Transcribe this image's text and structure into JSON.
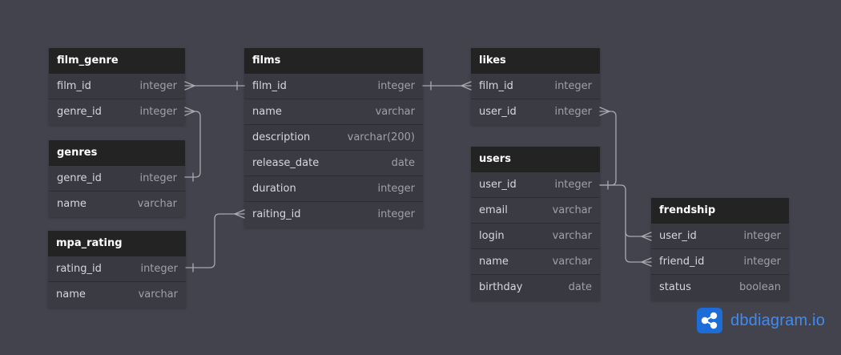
{
  "tables": {
    "film_genre": {
      "title": "film_genre",
      "columns": [
        {
          "name": "film_id",
          "type": "integer"
        },
        {
          "name": "genre_id",
          "type": "integer"
        }
      ]
    },
    "genres": {
      "title": "genres",
      "columns": [
        {
          "name": "genre_id",
          "type": "integer"
        },
        {
          "name": "name",
          "type": "varchar"
        }
      ]
    },
    "mpa_rating": {
      "title": "mpa_rating",
      "columns": [
        {
          "name": "rating_id",
          "type": "integer"
        },
        {
          "name": "name",
          "type": "varchar"
        }
      ]
    },
    "films": {
      "title": "films",
      "columns": [
        {
          "name": "film_id",
          "type": "integer"
        },
        {
          "name": "name",
          "type": "varchar"
        },
        {
          "name": "description",
          "type": "varchar(200)"
        },
        {
          "name": "release_date",
          "type": "date"
        },
        {
          "name": "duration",
          "type": "integer"
        },
        {
          "name": "raiting_id",
          "type": "integer"
        }
      ]
    },
    "likes": {
      "title": "likes",
      "columns": [
        {
          "name": "film_id",
          "type": "integer"
        },
        {
          "name": "user_id",
          "type": "integer"
        }
      ]
    },
    "users": {
      "title": "users",
      "columns": [
        {
          "name": "user_id",
          "type": "integer"
        },
        {
          "name": "email",
          "type": "varchar"
        },
        {
          "name": "login",
          "type": "varchar"
        },
        {
          "name": "name",
          "type": "varchar"
        },
        {
          "name": "birthday",
          "type": "date"
        }
      ]
    },
    "frendship": {
      "title": "frendship",
      "columns": [
        {
          "name": "user_id",
          "type": "integer"
        },
        {
          "name": "friend_id",
          "type": "integer"
        },
        {
          "name": "status",
          "type": "boolean"
        }
      ]
    }
  },
  "relations": [
    {
      "from": "film_genre.film_id",
      "to": "films.film_id",
      "type": "many-to-one"
    },
    {
      "from": "film_genre.genre_id",
      "to": "genres.genre_id",
      "type": "many-to-one"
    },
    {
      "from": "films.raiting_id",
      "to": "mpa_rating.rating_id",
      "type": "many-to-one"
    },
    {
      "from": "likes.film_id",
      "to": "films.film_id",
      "type": "many-to-one"
    },
    {
      "from": "likes.user_id",
      "to": "users.user_id",
      "type": "many-to-one"
    },
    {
      "from": "frendship.user_id",
      "to": "users.user_id",
      "type": "many-to-one"
    },
    {
      "from": "frendship.friend_id",
      "to": "users.user_id",
      "type": "many-to-one"
    }
  ],
  "branding": {
    "name": "dbdiagram.io",
    "icon": "share-nodes-icon",
    "accent_color": "#1c6dd8"
  },
  "colors": {
    "canvas": "#43434e",
    "header": "#232323",
    "line": "#a9a9b1"
  }
}
